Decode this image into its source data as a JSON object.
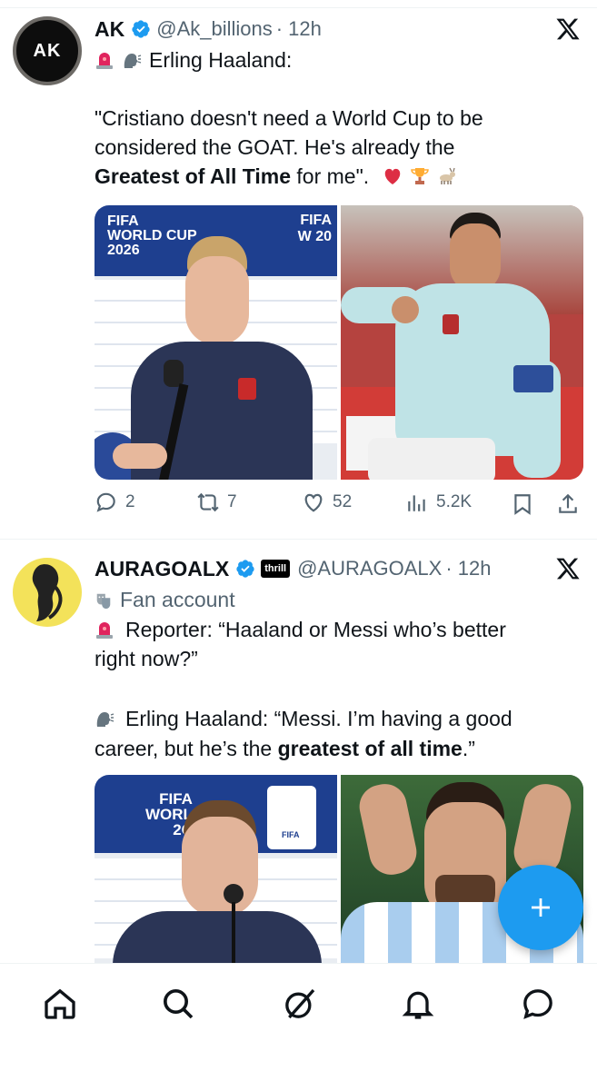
{
  "tweets": [
    {
      "avatar_text": "AK",
      "name": "AK",
      "handle": "@Ak_billions",
      "time": "· 12h",
      "lines": [
        "Erling Haaland:",
        "",
        "\"Cristiano doesn't need a World Cup to be",
        "considered the GOAT. He's already the"
      ],
      "bold": "Greatest of All Time",
      "after_bold": " for me\".",
      "image_texts": {
        "left_top": "FIFA\nWORLD CUP\n2026",
        "right_top": "FIFA\nW 20"
      },
      "stats": {
        "replies": "2",
        "reposts": "7",
        "likes": "52",
        "views": "5.2K"
      }
    },
    {
      "name": "AURAGOALX",
      "sponsor_badge": "thrill",
      "handle": "@AURAGOALX",
      "time": "· 12h",
      "account_label": "Fan account",
      "line1": "Reporter: “Haaland or Messi who’s better",
      "line2": "right now?”",
      "line3": "Erling Haaland: “Messi. I’m having a good",
      "line4_pre": "career, but he’s the ",
      "line4_bold": "greatest of all time",
      "line4_post": ".”",
      "image_texts": {
        "left_top": "FIFA\nWORL\n20",
        "fifa_small": "FIFA"
      }
    }
  ],
  "colors": {
    "accent": "#1d9bf0",
    "secondary_text": "#536471",
    "divider": "#eff3f4"
  },
  "icons": [
    "verified-icon",
    "x-logo-icon",
    "reply-icon",
    "repost-icon",
    "like-icon",
    "views-icon",
    "bookmark-icon",
    "share-icon",
    "home-icon",
    "search-icon",
    "grok-icon",
    "notifications-icon",
    "messages-icon",
    "compose-icon"
  ]
}
